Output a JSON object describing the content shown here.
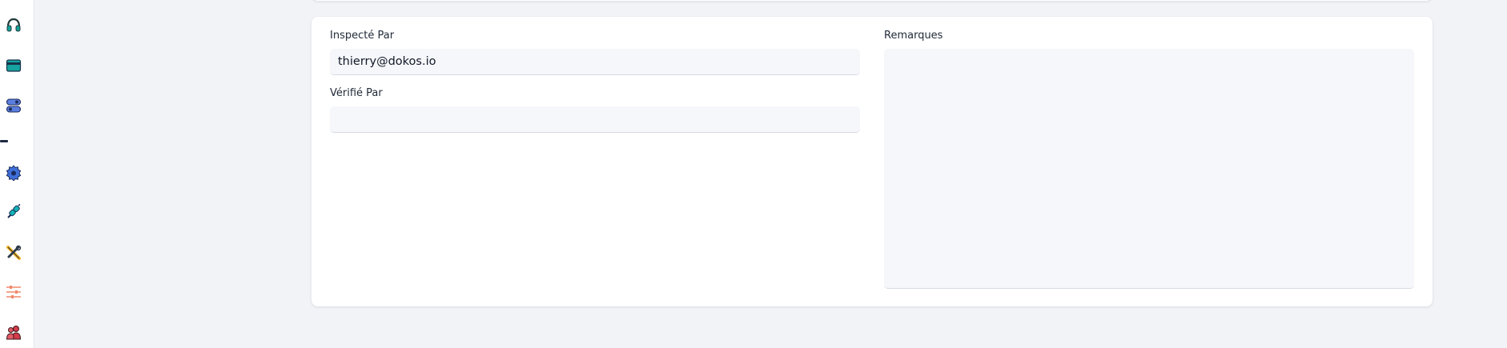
{
  "sidebar": {
    "items": [
      {
        "icon": "headset-icon"
      },
      {
        "icon": "card-icon"
      },
      {
        "icon": "toggle-stack-icon"
      },
      {
        "icon": "gear-icon"
      },
      {
        "icon": "plug-icon"
      },
      {
        "icon": "tools-icon"
      },
      {
        "icon": "sliders-icon"
      },
      {
        "icon": "users-icon"
      }
    ]
  },
  "form": {
    "inspected_by": {
      "label": "Inspecté Par",
      "value": "thierry@dokos.io"
    },
    "verified_by": {
      "label": "Vérifié Par",
      "value": ""
    },
    "remarks": {
      "label": "Remarques",
      "value": ""
    }
  },
  "colors": {
    "page_background": "#f1f3f7",
    "card_background": "#ffffff",
    "input_background": "#f6f7fb"
  }
}
